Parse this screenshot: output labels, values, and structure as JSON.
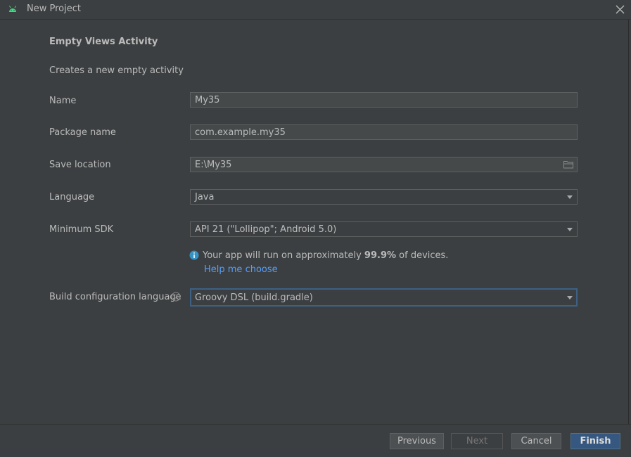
{
  "window": {
    "title": "New Project"
  },
  "page": {
    "heading": "Empty Views Activity",
    "description": "Creates a new empty activity"
  },
  "form": {
    "name": {
      "label": "Name",
      "value": "My35"
    },
    "package": {
      "label": "Package name",
      "value": "com.example.my35"
    },
    "save_location": {
      "label": "Save location",
      "value": "E:\\My35"
    },
    "language": {
      "label": "Language",
      "value": "Java"
    },
    "min_sdk": {
      "label": "Minimum SDK",
      "value": "API 21 (\"Lollipop\"; Android 5.0)"
    },
    "build_config": {
      "label": "Build configuration language",
      "value": "Groovy DSL (build.gradle)"
    }
  },
  "info": {
    "text_before": "Your app will run on approximately ",
    "percent": "99.9%",
    "text_after": " of devices.",
    "help_link": "Help me choose"
  },
  "footer": {
    "previous": "Previous",
    "next": "Next",
    "cancel": "Cancel",
    "finish": "Finish"
  },
  "colors": {
    "background": "#3c3f41",
    "accent": "#365880",
    "link": "#589df6"
  }
}
